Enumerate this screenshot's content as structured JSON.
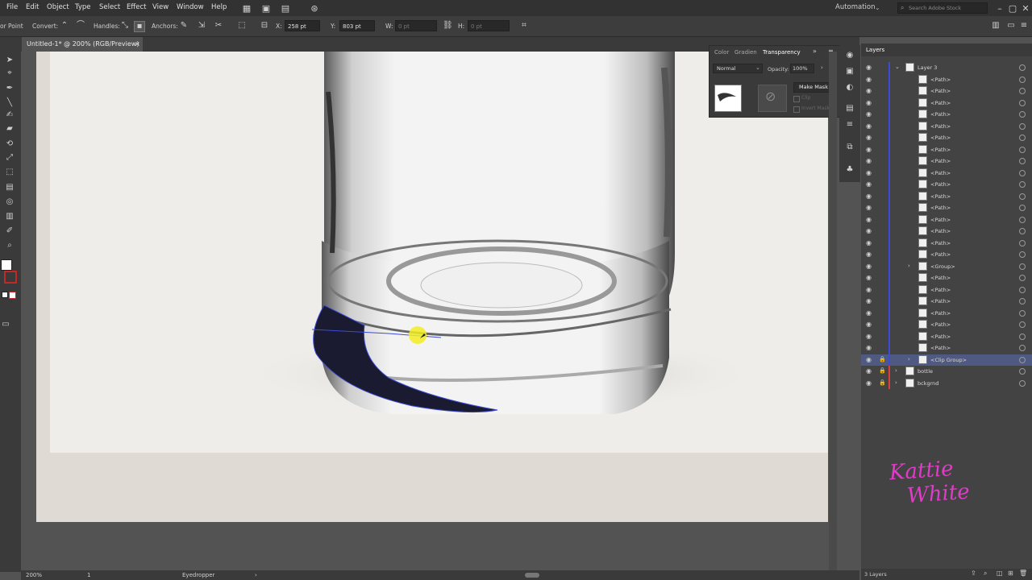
{
  "menubar": {
    "items": [
      "File",
      "Edit",
      "Object",
      "Type",
      "Select",
      "Effect",
      "View",
      "Window",
      "Help"
    ],
    "workspace": "Automation",
    "search_placeholder": "Search Adobe Stock"
  },
  "controlbar": {
    "anchor_point": "or Point",
    "convert": "Convert:",
    "handles": "Handles:",
    "anchors": "Anchors:",
    "x_label": "X:",
    "x_value": "258 pt",
    "y_label": "Y:",
    "y_value": "803 pt",
    "w_label": "W:",
    "w_value": "0 pt",
    "h_label": "H:",
    "h_value": "0 pt"
  },
  "document": {
    "tab_title": "Untitled-1* @ 200% (RGB/Preview)",
    "close_glyph": "×"
  },
  "transparency_panel": {
    "tabs": [
      "Color",
      "Gradien",
      "Transparency"
    ],
    "blend_mode": "Normal",
    "opacity_label": "Opacity:",
    "opacity_value": "100%",
    "make_mask": "Make Mask",
    "clip": "Clip",
    "invert_mask": "Invert Mask"
  },
  "layers_panel": {
    "title": "Layers",
    "rows": [
      {
        "name": "Layer 3",
        "kind": "layer"
      },
      {
        "name": "<Path>"
      },
      {
        "name": "<Path>"
      },
      {
        "name": "<Path>"
      },
      {
        "name": "<Path>"
      },
      {
        "name": "<Path>"
      },
      {
        "name": "<Path>"
      },
      {
        "name": "<Path>"
      },
      {
        "name": "<Path>"
      },
      {
        "name": "<Path>"
      },
      {
        "name": "<Path>"
      },
      {
        "name": "<Path>"
      },
      {
        "name": "<Path>"
      },
      {
        "name": "<Path>"
      },
      {
        "name": "<Path>"
      },
      {
        "name": "<Path>"
      },
      {
        "name": "<Path>"
      },
      {
        "name": "<Group>"
      },
      {
        "name": "<Path>"
      },
      {
        "name": "<Path>"
      },
      {
        "name": "<Path>"
      },
      {
        "name": "<Path>"
      },
      {
        "name": "<Path>"
      },
      {
        "name": "<Path>"
      },
      {
        "name": "<Path>"
      },
      {
        "name": "<Clip Group>"
      },
      {
        "name": "bottle",
        "kind": "layer"
      },
      {
        "name": "bckgrnd",
        "kind": "layer"
      }
    ],
    "footer_count": "3 Layers"
  },
  "statusbar": {
    "zoom": "200%",
    "artboard": "1",
    "tool": "Eyedropper"
  },
  "colors": {
    "accent_selection": "#3d4bd6",
    "watermark": "#e03cc8"
  },
  "watermark": {
    "line1": "Kattie",
    "line2": "White"
  }
}
